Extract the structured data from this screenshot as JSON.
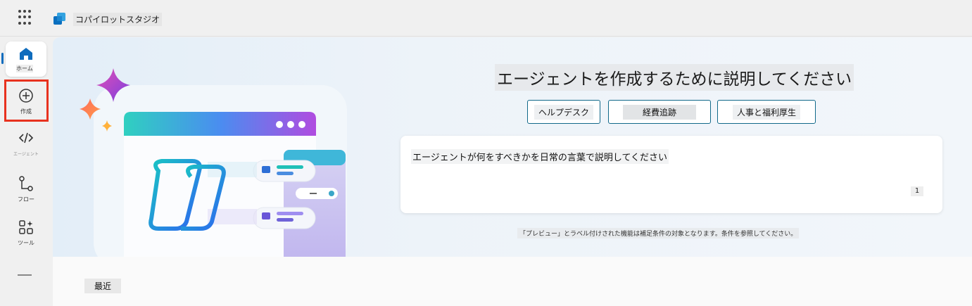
{
  "app": {
    "title": "コパイロットスタジオ"
  },
  "rail": {
    "items": [
      {
        "label": "ホーム",
        "icon": "home-icon"
      },
      {
        "label": "作成",
        "icon": "add-circle-icon"
      },
      {
        "label": "エージェント",
        "icon": "code-icon"
      },
      {
        "label": "フロー",
        "icon": "flow-icon"
      },
      {
        "label": "ツール",
        "icon": "tools-icon"
      }
    ]
  },
  "hero": {
    "heading": "エージェントを作成するために説明してください",
    "chips": [
      "ヘルプデスク",
      "経費追跡",
      "人事と福利厚生"
    ],
    "prompt_placeholder": "エージェントが何をすべきかを日常の言葉で説明してください",
    "send_label": "1",
    "disclaimer": "「プレビュー」とラベル付けされた機能は補足条件の対象となります。条件を参照してください。"
  },
  "recent": {
    "label": "最近"
  },
  "colors": {
    "accent": "#0f6cbd",
    "chip_border": "#11698a",
    "highlight": "#e8321f"
  }
}
